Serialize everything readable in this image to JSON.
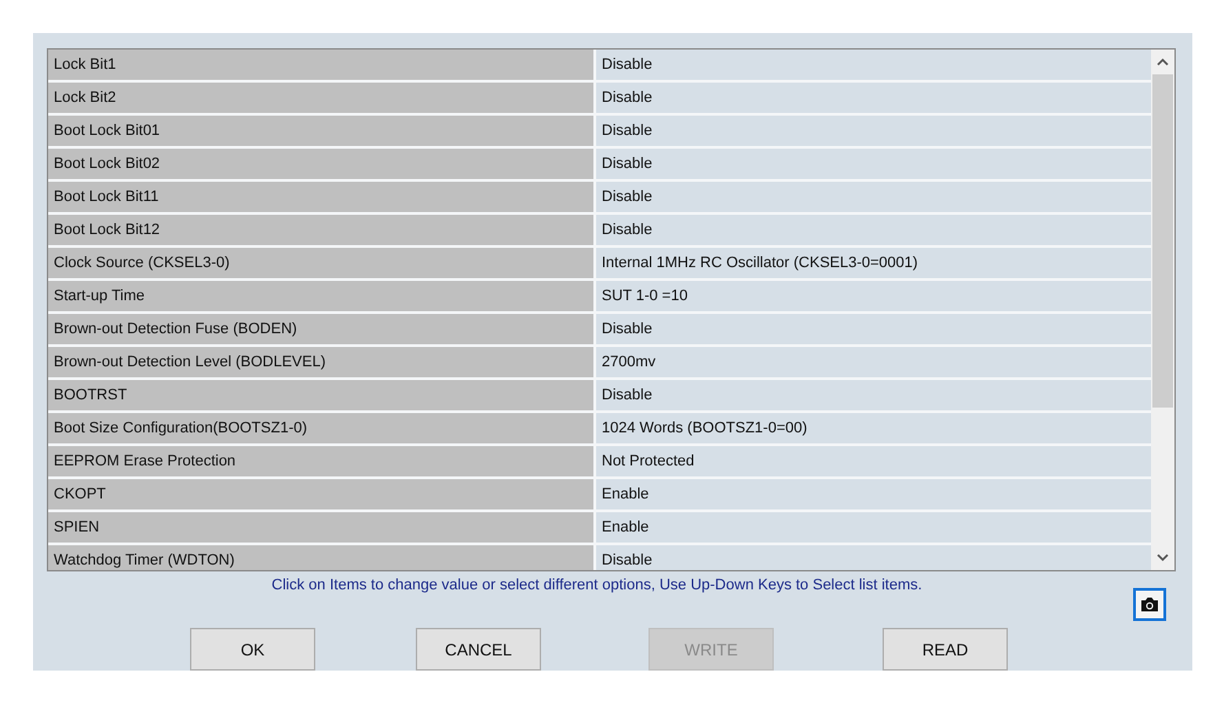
{
  "table": {
    "rows": [
      {
        "name": "Lock Bit1",
        "value": "Disable"
      },
      {
        "name": "Lock Bit2",
        "value": "Disable"
      },
      {
        "name": "Boot Lock Bit01",
        "value": "Disable"
      },
      {
        "name": "Boot Lock Bit02",
        "value": "Disable"
      },
      {
        "name": "Boot Lock Bit11",
        "value": "Disable"
      },
      {
        "name": "Boot Lock Bit12",
        "value": "Disable"
      },
      {
        "name": "Clock Source (CKSEL3-0)",
        "value": "Internal 1MHz RC Oscillator (CKSEL3-0=0001)"
      },
      {
        "name": "Start-up Time",
        "value": "SUT 1-0 =10"
      },
      {
        "name": "Brown-out Detection Fuse (BODEN)",
        "value": "Disable"
      },
      {
        "name": "Brown-out Detection Level (BODLEVEL)",
        "value": "2700mv"
      },
      {
        "name": "BOOTRST",
        "value": "Disable"
      },
      {
        "name": "Boot Size Configuration(BOOTSZ1-0)",
        "value": "1024 Words (BOOTSZ1-0=00)"
      },
      {
        "name": "EEPROM Erase Protection",
        "value": "Not Protected"
      },
      {
        "name": "CKOPT",
        "value": "Enable"
      },
      {
        "name": "SPIEN",
        "value": "Enable"
      },
      {
        "name": "Watchdog Timer (WDTON)",
        "value": "Disable"
      }
    ]
  },
  "hint": "Click on Items to change value or select different options, Use Up-Down Keys to Select list items.",
  "buttons": [
    {
      "label": "OK",
      "disabled": false
    },
    {
      "label": "CANCEL",
      "disabled": false
    },
    {
      "label": "WRITE",
      "disabled": true
    },
    {
      "label": "READ",
      "disabled": false
    }
  ]
}
